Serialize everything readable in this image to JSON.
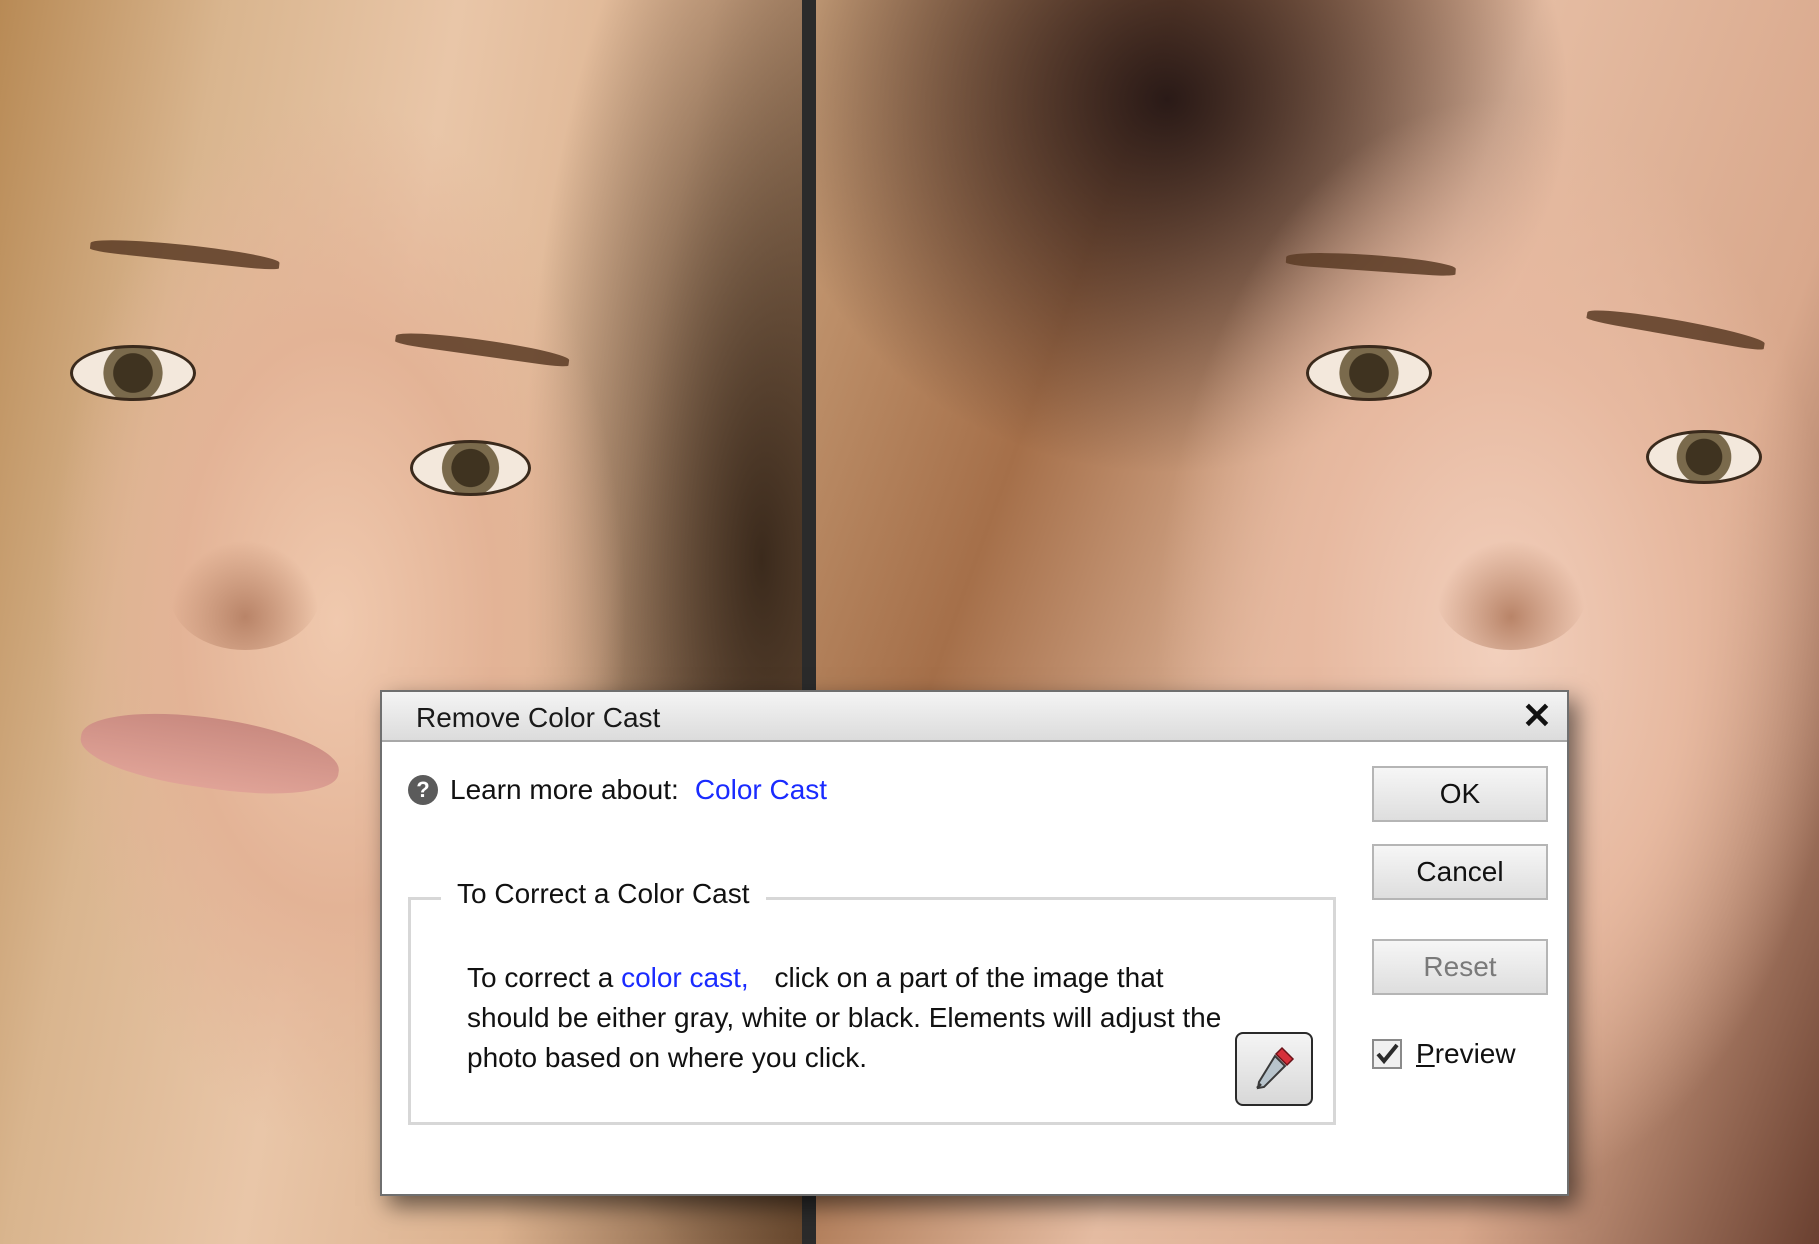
{
  "dialog": {
    "title": "Remove Color Cast",
    "learn_more_label": "Learn more about:",
    "learn_more_link": "Color Cast",
    "group_title": "To Correct a Color Cast",
    "instructions_prefix": "To correct a",
    "instructions_link": "color cast,",
    "instructions_suffix": "click on a part of the image that should be either gray, white or black. Elements will adjust the photo based on where you click.",
    "buttons": {
      "ok": "OK",
      "cancel": "Cancel",
      "reset": "Reset"
    },
    "preview": {
      "label_underlined": "P",
      "label_rest": "review",
      "checked": true
    },
    "icons": {
      "close": "close-icon",
      "help": "question-mark-icon",
      "eyedropper": "eyedropper-icon",
      "check": "checkmark-icon"
    },
    "colors": {
      "link": "#1a2bff",
      "reset_text": "#7a7a7a"
    }
  }
}
